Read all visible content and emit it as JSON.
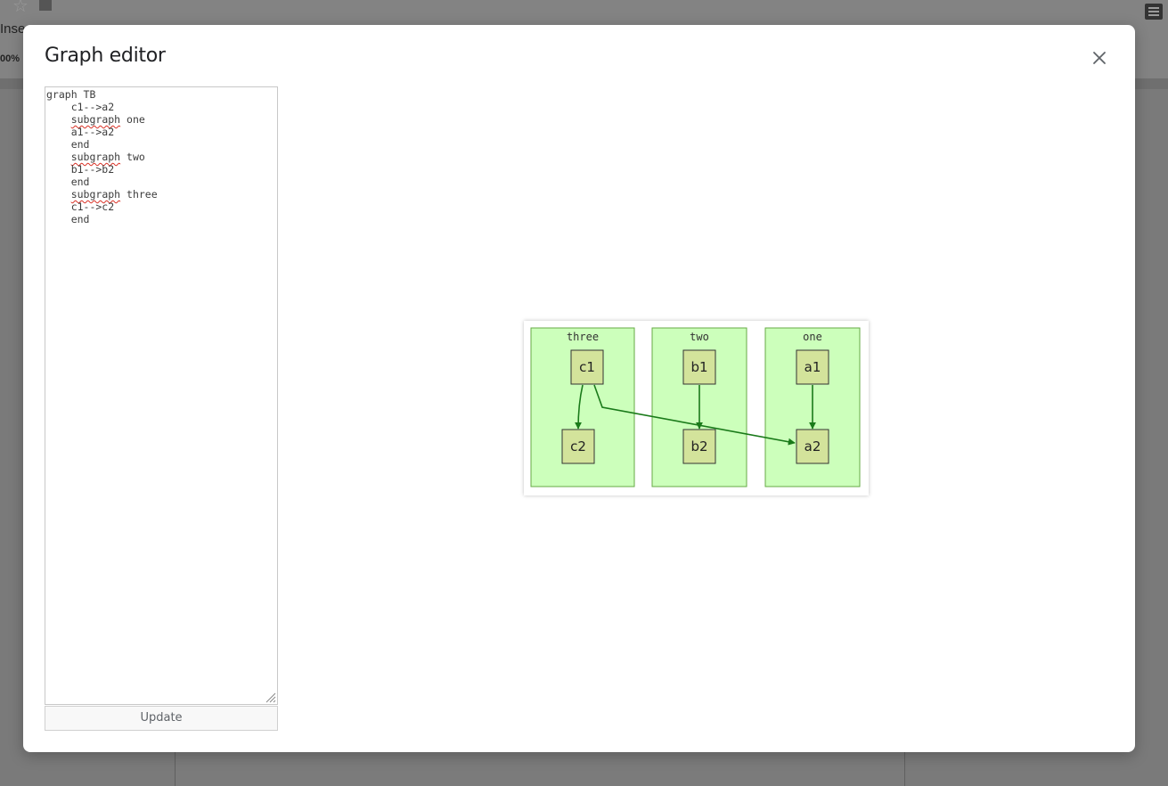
{
  "background": {
    "menu_insert": "Inse",
    "menu_rest": "",
    "zoom": "00%"
  },
  "dialog": {
    "title": "Graph editor",
    "code": "graph TB\n    c1-->a2\n    subgraph one\n    a1-->a2\n    end\n    subgraph two\n    b1-->b2\n    end\n    subgraph three\n    c1-->c2\n    end",
    "update_label": "Update"
  },
  "graph": {
    "clusters": [
      {
        "name": "three",
        "nodes": [
          "c1",
          "c2"
        ]
      },
      {
        "name": "two",
        "nodes": [
          "b1",
          "b2"
        ]
      },
      {
        "name": "one",
        "nodes": [
          "a1",
          "a2"
        ]
      }
    ],
    "edges": [
      {
        "from": "c1",
        "to": "c2"
      },
      {
        "from": "c1",
        "to": "a2"
      },
      {
        "from": "b1",
        "to": "b2"
      },
      {
        "from": "a1",
        "to": "a2"
      }
    ]
  },
  "colors": {
    "cluster_fill": "#ccffbb",
    "cluster_stroke": "#66aa44",
    "node_fill": "#d3e39b",
    "node_stroke": "#333333",
    "edge": "#1a7a1a"
  },
  "icons": {
    "close": "close-icon",
    "resize": "resize-handle-icon"
  }
}
